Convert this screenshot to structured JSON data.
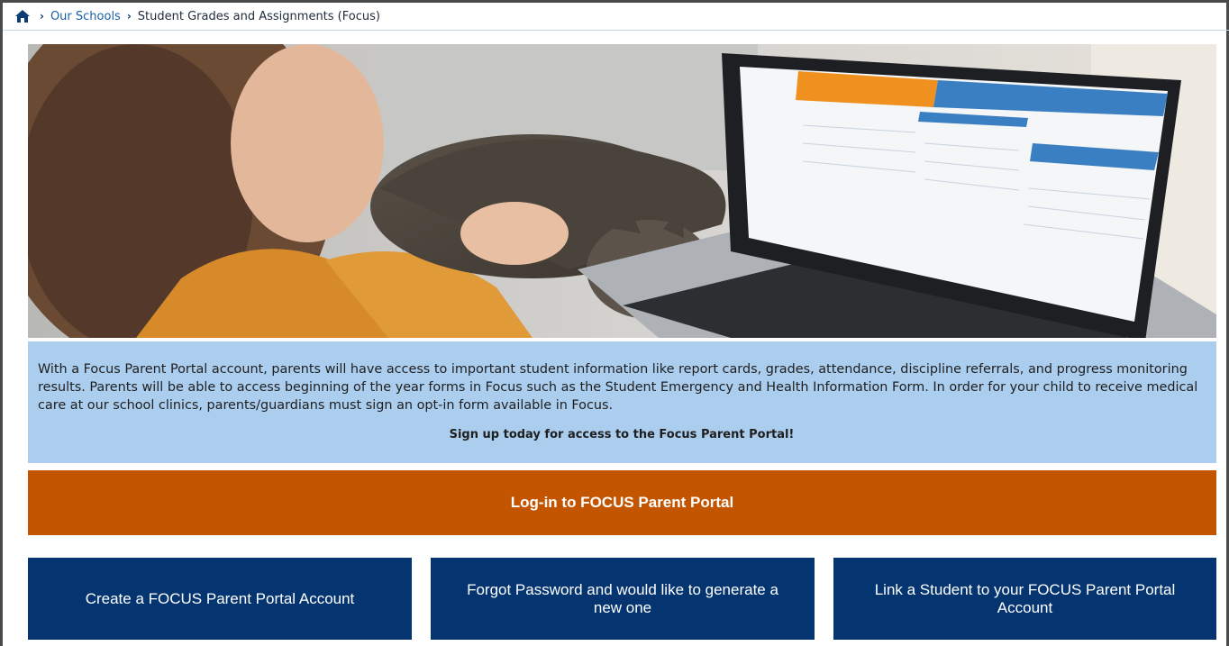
{
  "breadcrumb": {
    "home_icon": "home-icon",
    "separator_icon": "chevron-right-icon",
    "items": [
      {
        "label": "Our Schools"
      },
      {
        "label": "Student Grades and Assignments (Focus)"
      }
    ]
  },
  "hero": {
    "image": "photo of a woman with a tabby cat using a laptop showing the Focus portal"
  },
  "info": {
    "paragraph": "With a Focus Parent Portal account, parents will have access to important student information like report cards, grades, attendance, discipline referrals, and progress monitoring results. Parents will be able to access beginning of the year forms in Focus such as the Student Emergency and Health Information Form. In order for your child to receive medical care at our school clinics, parents/guardians must sign an opt-in form available in Focus.",
    "cta": "Sign up today for access to the Focus Parent Portal!"
  },
  "buttons": {
    "login": "Log-in to FOCUS Parent Portal",
    "create": "Create a FOCUS Parent Portal Account",
    "forgot": "Forgot Password and would like to generate a new one",
    "link": "Link a Student to your FOCUS Parent Portal Account"
  },
  "colors": {
    "breadcrumb_link": "#1a5fa6",
    "info_bg": "#abcdee",
    "login_bg": "#c45500",
    "action_bg": "#053571"
  }
}
